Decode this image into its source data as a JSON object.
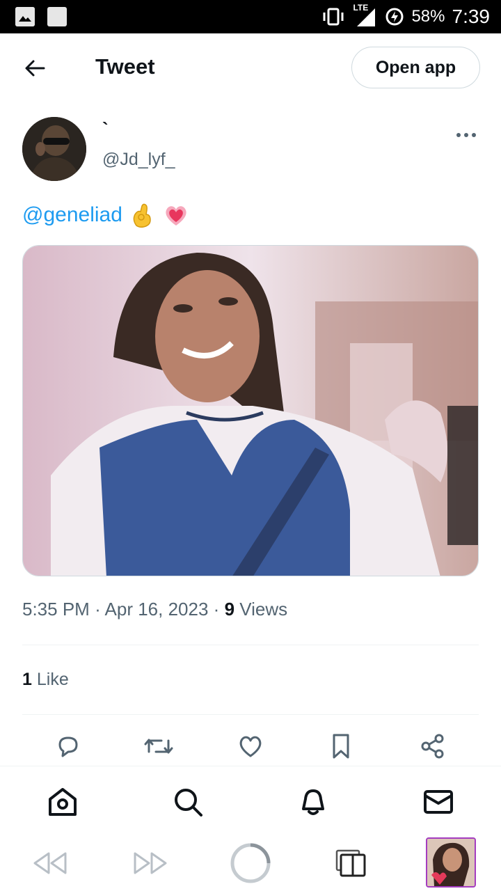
{
  "status_bar": {
    "network": "LTE",
    "battery": "58%",
    "time": "7:39"
  },
  "header": {
    "title": "Tweet",
    "open_app": "Open app"
  },
  "author": {
    "display_name": "`",
    "handle": "@Jd_lyf_"
  },
  "tweet": {
    "mention": "@geneliad",
    "emojis": [
      "pinching-hand",
      "growing-heart"
    ]
  },
  "meta": {
    "time": "5:35 PM",
    "separator": "·",
    "date": "Apr 16, 2023",
    "views_count": "9",
    "views_label": "Views"
  },
  "stats": {
    "likes_count": "1",
    "likes_label": "Like"
  },
  "actions": [
    "reply-icon",
    "retweet-icon",
    "like-icon",
    "bookmark-icon",
    "share-icon"
  ],
  "bottom_nav": [
    "home-icon",
    "search-icon",
    "notifications-icon",
    "messages-icon"
  ],
  "browser_bar": [
    "back-icon",
    "forward-icon",
    "reload-icon",
    "tabs-icon",
    "tab-thumbnail"
  ],
  "colors": {
    "accent": "#1d9bf0",
    "text": "#0f1419",
    "secondary": "#536471",
    "border": "#cfd9de",
    "tab_highlight": "#a43cc0"
  }
}
